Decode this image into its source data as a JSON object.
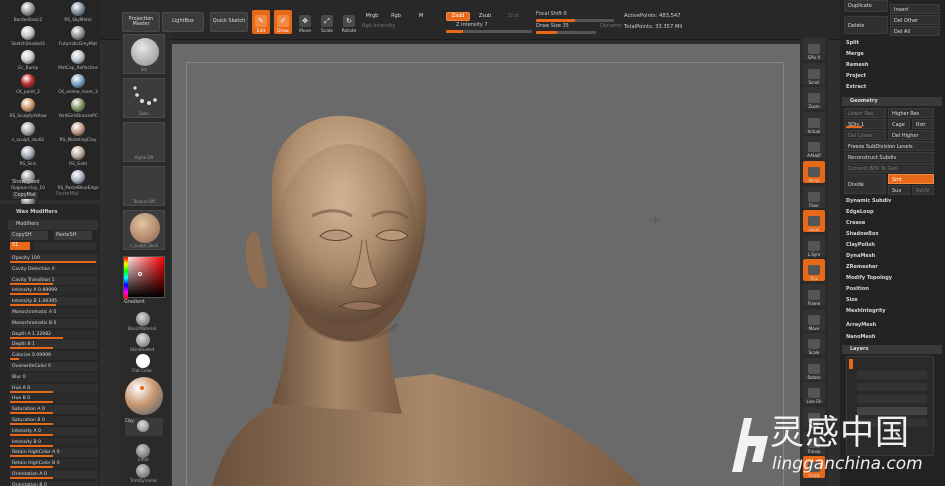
{
  "materials": [
    {
      "label": "BorderBasic2",
      "color": "#a0a0a0"
    },
    {
      "label": "RS_SkyMetal",
      "color": "#8a9aa8"
    },
    {
      "label": "SketchShaded3",
      "color": "#c8c8c8"
    },
    {
      "label": "FuturisticGreyMat",
      "color": "#9a9a9a"
    },
    {
      "label": "Gc_Bump",
      "color": "#d0d0d0"
    },
    {
      "label": "MatCap_Reflective",
      "color": "#bfc7cf"
    },
    {
      "label": "CK_paint_2",
      "color": "#c23030"
    },
    {
      "label": "CK_anime_more_3",
      "color": "#7fa8c8"
    },
    {
      "label": "RS_SculptyYellow",
      "color": "#d0a070"
    },
    {
      "label": "YardGirlsBronzePC",
      "color": "#8aa070"
    },
    {
      "label": "c_sculpt_skull2",
      "color": "#b0b0b0"
    },
    {
      "label": "RS_ModelingClay",
      "color": "#c8a090"
    },
    {
      "label": "RS_Skin",
      "color": "#a8b0b8"
    },
    {
      "label": "RS_Gold",
      "color": "#c0b0a0"
    },
    {
      "label": "Rugous-clay_10",
      "color": "#a0a0a0"
    },
    {
      "label": "RS_PastelBlueEdge",
      "color": "#b0b8c8"
    },
    {
      "label": "RS_GreyMesh",
      "color": "#909090"
    }
  ],
  "left_panel": {
    "show_used": "Show Used",
    "copy_mat": "CopyMat",
    "paste_mat": "PasteMat",
    "wax_modifiers": "Wax Modifiers",
    "modifiers": "Modifiers",
    "copy_sh": "CopySH",
    "paste_sh": "PasteSH",
    "slot": "S1",
    "rows": [
      {
        "label": "Opacity 100",
        "fill": 1.0
      },
      {
        "label": "Cavity Detection 0",
        "fill": 0
      },
      {
        "label": "Cavity Transition 1",
        "fill": 0.5
      },
      {
        "label": "Intensity A 0.89999",
        "fill": 0.45
      },
      {
        "label": "Intensity B 1.06395",
        "fill": 0.53
      },
      {
        "label": "Monochromatic A 0",
        "fill": 0
      },
      {
        "label": "Monochromatic B 0",
        "fill": 0
      },
      {
        "label": "Depth A 1.22982",
        "fill": 0.62
      },
      {
        "label": "Depth B 1",
        "fill": 0.5
      },
      {
        "label": "Colorize 0.09999",
        "fill": 0.1
      },
      {
        "label": "OverwriteColor 0",
        "fill": 0
      },
      {
        "label": "Blur 0",
        "fill": 0
      },
      {
        "label": "Hue A 0",
        "fill": 0.5
      },
      {
        "label": "Hue B 0",
        "fill": 0.5
      },
      {
        "label": "Saturation A 0",
        "fill": 0.5
      },
      {
        "label": "Saturation B 0",
        "fill": 0.5
      },
      {
        "label": "Intensity A 0",
        "fill": 0.5
      },
      {
        "label": "Intensity B 0",
        "fill": 0.5
      },
      {
        "label": "Retain HighColor A 0",
        "fill": 0.5
      },
      {
        "label": "Retain HighColor B 0",
        "fill": 0.5
      },
      {
        "label": "Orientation A 0",
        "fill": 0.5
      },
      {
        "label": "Orientation B 0",
        "fill": 0.5
      }
    ]
  },
  "toolbar": {
    "projection_master": "Projection Master",
    "lightbox": "LightBox",
    "quick_sketch": "Quick Sketch",
    "edit": "Edit",
    "draw": "Draw",
    "move": "Move",
    "scale": "Scale",
    "rotate": "Rotate",
    "mrgb": "Mrgb",
    "rgb": "Rgb",
    "m": "M",
    "rgb_intensity": "Rgb Intensity",
    "zadd": "Zadd",
    "zsub": "Zsub",
    "zcut": "Zcut",
    "z_intensity": "Z Intensity 7",
    "focal_shift": "Focal Shift 0",
    "draw_size": "Draw Size 35",
    "dynamic": "Dynamic",
    "active_points": "ActivePoints: 483,547",
    "total_points": "TotalPoints: 33.357 Mil",
    "z_intensity_fill": 0.2,
    "focal_shift_fill": 0.5,
    "draw_size_fill": 0.35
  },
  "shelf": {
    "items": [
      "Sm",
      "Dots",
      "Alpha Off",
      "Texture Off",
      "c_sculpt_Skull"
    ],
    "gradient": "Gradient",
    "basic_material": "BasicMaterial",
    "skin_shade": "SkinShade4",
    "flat_color": "Flat Color",
    "clay": "Clay",
    "inflat": "Inflat",
    "trim_dynamic": "TrimDynamic"
  },
  "right_tools": [
    {
      "label": "SPix 0",
      "on": false
    },
    {
      "label": "Scroll",
      "on": false
    },
    {
      "label": "Zoom",
      "on": false
    },
    {
      "label": "Actual",
      "on": false
    },
    {
      "label": "AAHalf",
      "on": false
    },
    {
      "label": "Persp",
      "on": true
    },
    {
      "label": "Floor",
      "on": false
    },
    {
      "label": "Local",
      "on": true
    },
    {
      "label": "L.Sym",
      "on": false
    },
    {
      "label": "Xyz",
      "on": true
    },
    {
      "label": "Frame",
      "on": false
    },
    {
      "label": "Move",
      "on": false
    },
    {
      "label": "Scale",
      "on": false
    },
    {
      "label": "Rotate",
      "on": false
    },
    {
      "label": "Line Fill",
      "on": false
    },
    {
      "label": "PolyF",
      "on": false
    },
    {
      "label": "Transp",
      "on": false
    },
    {
      "label": "Ghost",
      "on": true
    }
  ],
  "right_menu": {
    "duplicate": "Duplicate",
    "insert": "Insert",
    "delete": "Delete",
    "del_other": "Del Other",
    "del_all": "Del All",
    "split": "Split",
    "merge": "Merge",
    "remesh": "Remesh",
    "project": "Project",
    "extract": "Extract",
    "geometry": "Geometry",
    "lower_res": "Lower Res",
    "higher_res": "Higher Res",
    "sdiv": "SDiv 1",
    "cage": "Cage",
    "rstr": "Rstr",
    "del_lower": "Del Lower",
    "del_higher": "Del Higher",
    "freeze": "Freeze SubDivision Levels",
    "reconstruct": "Reconstruct Subdiv",
    "convert_bpr": "Convert BPR To Geo",
    "divide": "Divide",
    "smt": "Smt",
    "suv": "Suv",
    "reuv": "ReUV",
    "list": [
      "Dynamic Subdiv",
      "EdgeLoop",
      "Crease",
      "ShadowBox",
      "ClayPolish",
      "DynaMesh",
      "ZRemesher",
      "Modify Topology",
      "Position",
      "Size",
      "MeshIntegrity"
    ],
    "array_mesh": "ArrayMesh",
    "nano_mesh": "NanoMesh",
    "layers": "Layers"
  },
  "watermark": {
    "brand": "灵感中国",
    "url": "lingganchina.com"
  }
}
